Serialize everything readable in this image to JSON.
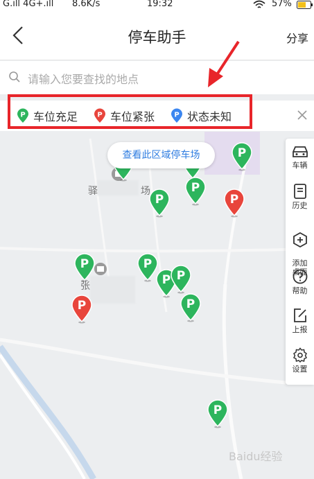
{
  "status_bar": {
    "carrier": "G.ıll 4G+.ıll",
    "speed": "8.6K/s",
    "time": "19:32",
    "battery": "57%"
  },
  "header": {
    "title": "停车助手",
    "share_label": "分享"
  },
  "search": {
    "placeholder": "请输入您要查找的地点"
  },
  "legend": {
    "items": [
      {
        "label": "车位充足",
        "color": "#2db55d"
      },
      {
        "label": "车位紧张",
        "color": "#e8453c"
      },
      {
        "label": "状态未知",
        "color": "#3b86f0"
      }
    ]
  },
  "map": {
    "area_button_label": "查看此区域停车场",
    "pin_letter": "P",
    "pins": [
      {
        "status": "available"
      },
      {
        "status": "available"
      },
      {
        "status": "available"
      },
      {
        "status": "available"
      },
      {
        "status": "full"
      },
      {
        "status": "available"
      },
      {
        "status": "available"
      },
      {
        "status": "available"
      },
      {
        "status": "full"
      },
      {
        "status": "available"
      },
      {
        "status": "available"
      },
      {
        "status": "available"
      },
      {
        "status": "available"
      }
    ],
    "place_fragments": [
      "驿",
      "场",
      "张"
    ]
  },
  "toolbar": {
    "items": [
      {
        "label": "车辆",
        "icon": "car-icon"
      },
      {
        "label": "历史",
        "icon": "history-icon"
      },
      {
        "label": "添加\n桌面",
        "icon": "add-desktop-icon"
      },
      {
        "label": "帮助",
        "icon": "help-icon"
      },
      {
        "label": "上报",
        "icon": "report-icon"
      },
      {
        "label": "设置",
        "icon": "settings-icon"
      }
    ]
  },
  "watermark": "Baidu经验"
}
